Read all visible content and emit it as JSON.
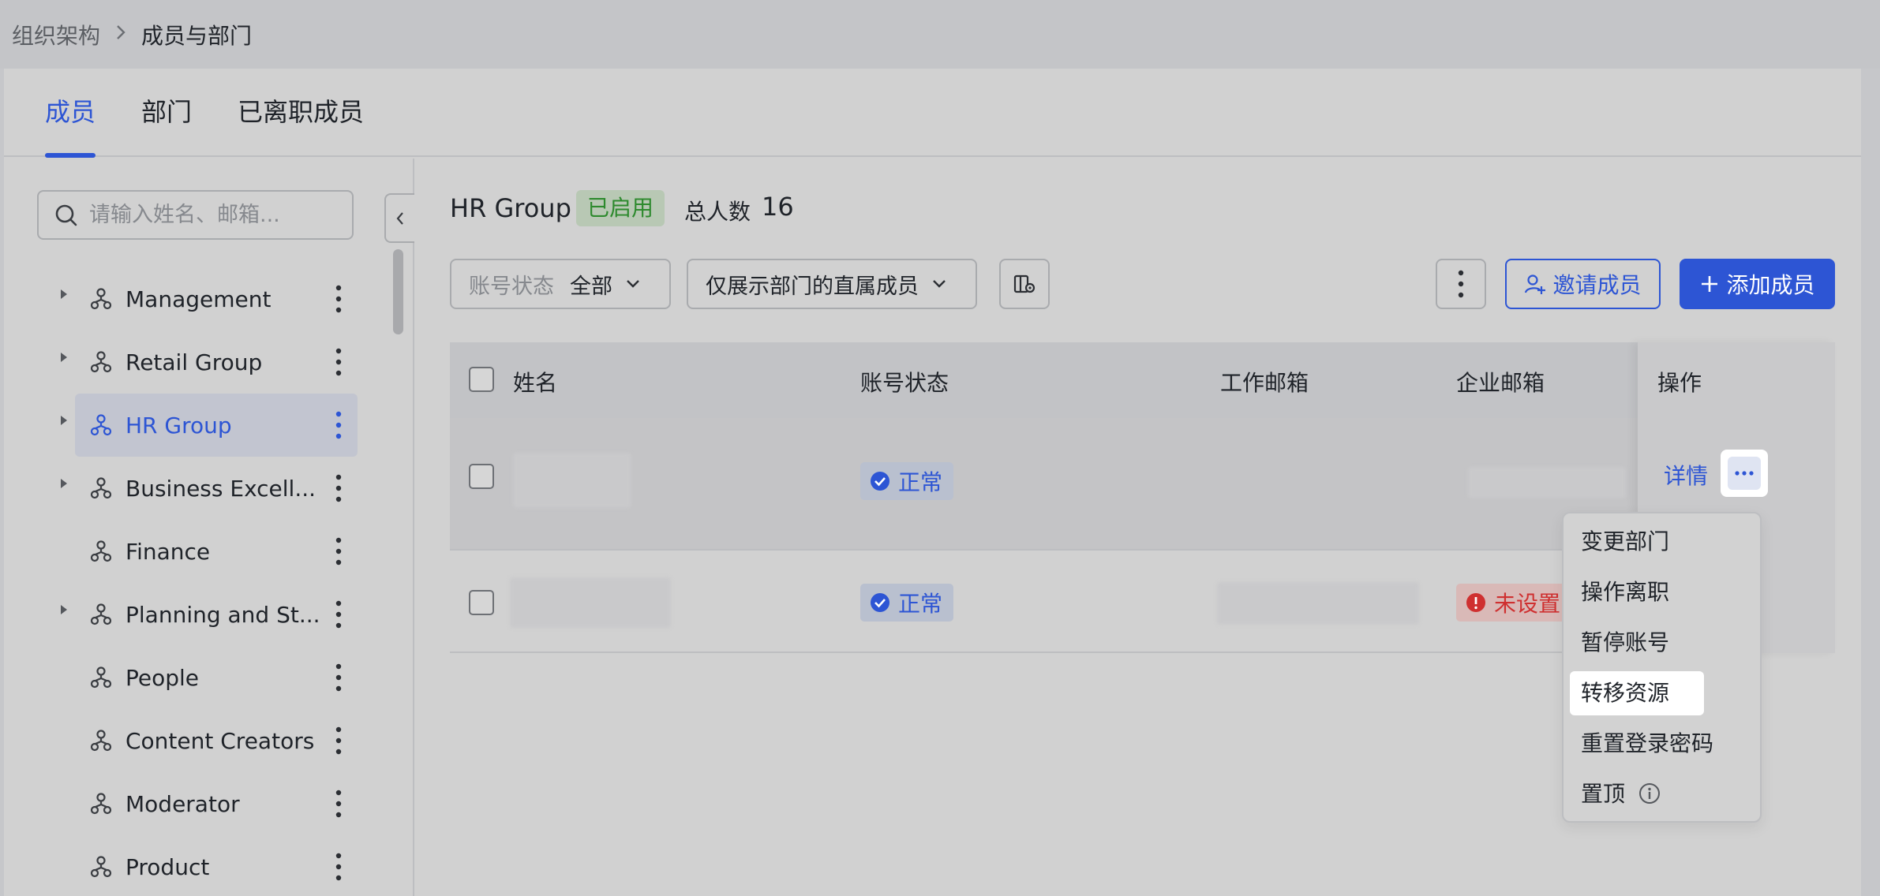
{
  "breadcrumb": {
    "parent": "组织架构",
    "separator": "›",
    "current": "成员与部门"
  },
  "tabs": [
    {
      "label": "成员",
      "active": true
    },
    {
      "label": "部门",
      "active": false
    },
    {
      "label": "已离职成员",
      "active": false
    }
  ],
  "sidebar": {
    "search_placeholder": "请输入姓名、邮箱...",
    "departments": [
      {
        "label": "Management",
        "expandable": true,
        "selected": false
      },
      {
        "label": "Retail Group",
        "expandable": true,
        "selected": false
      },
      {
        "label": "HR Group",
        "expandable": true,
        "selected": true
      },
      {
        "label": "Business Excell...",
        "expandable": true,
        "selected": false
      },
      {
        "label": "Finance",
        "expandable": false,
        "selected": false
      },
      {
        "label": "Planning and St...",
        "expandable": true,
        "selected": false
      },
      {
        "label": "People",
        "expandable": false,
        "selected": false
      },
      {
        "label": "Content Creators",
        "expandable": false,
        "selected": false
      },
      {
        "label": "Moderator",
        "expandable": false,
        "selected": false
      },
      {
        "label": "Product",
        "expandable": false,
        "selected": false
      }
    ]
  },
  "header": {
    "dept_name": "HR Group",
    "status": "已启用",
    "total_label": "总人数",
    "total_count": "16"
  },
  "filters": {
    "account_status_label": "账号状态",
    "account_status_value": "全部",
    "scope_value": "仅展示部门的直属成员"
  },
  "actions": {
    "invite": "邀请成员",
    "add": "添加成员"
  },
  "table": {
    "columns": [
      "姓名",
      "账号状态",
      "工作邮箱",
      "企业邮箱",
      "操作"
    ],
    "rows": [
      {
        "status": "正常",
        "enterprise_email": "",
        "detail": "详情",
        "more": "···"
      },
      {
        "status": "正常",
        "enterprise_email": "未设置"
      }
    ]
  },
  "menu": {
    "items": [
      "变更部门",
      "操作离职",
      "暂停账号",
      "转移资源",
      "重置登录密码",
      "置顶"
    ],
    "hovered_index": 3
  },
  "colors": {
    "accent": "#2d55d4",
    "success": "#2e8a2e",
    "danger": "#cf3030"
  }
}
